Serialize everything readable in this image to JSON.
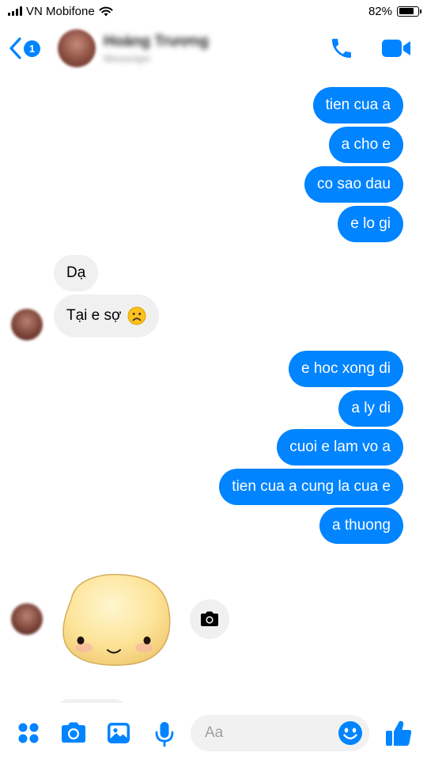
{
  "status": {
    "carrier": "VN Mobifone",
    "battery": "82%",
    "battery_level": 0.82
  },
  "header": {
    "back_badge": "1",
    "contact_name": "Hoàng Trương",
    "contact_sub": "Messenger"
  },
  "messages": {
    "m1": "tien cua a",
    "m2": "a cho e",
    "m3": "co sao dau",
    "m4": "e lo gi",
    "m5": "Dạ",
    "m6": "Tại e sợ",
    "m7": "e hoc xong di",
    "m8": "a ly di",
    "m9": "cuoi e lam vo a",
    "m10": "tien cua a cung la cua e",
    "m11": "a thuong"
  },
  "composer": {
    "placeholder": "Aa"
  },
  "icons": {
    "status": [
      "signal-icon",
      "wifi-icon",
      "battery-icon"
    ],
    "header": [
      "back-chevron-icon",
      "phone-icon",
      "video-camera-icon"
    ],
    "composer": [
      "apps-grid-icon",
      "camera-icon",
      "image-icon",
      "microphone-icon",
      "emoji-icon",
      "thumbs-up-icon"
    ]
  },
  "colors": {
    "accent": "#0084ff",
    "incoming_bubble": "#f1f0f0",
    "outgoing_text": "#ffffff"
  }
}
